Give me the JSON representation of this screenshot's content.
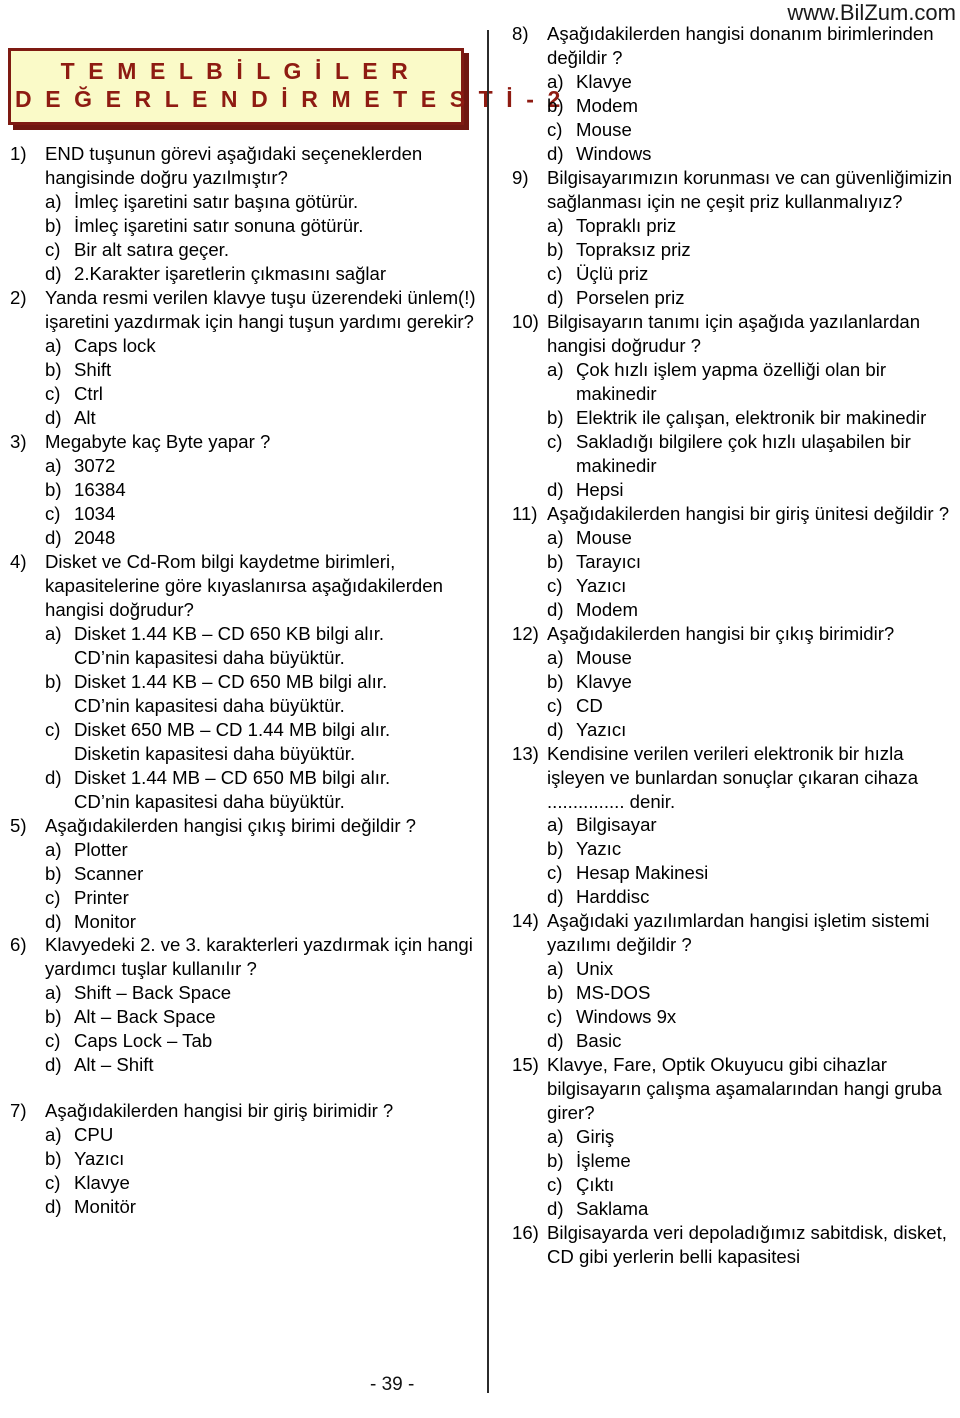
{
  "document": {
    "title_line_1": "T E M E L   B İ L G İ L E R",
    "title_line_2": "D E Ğ E R L E N D İ R M E   T E S T İ - 2",
    "watermark": "www.BilZum.com",
    "page_number": "- 39 -",
    "banner_fill_color": "#fafac8",
    "banner_border_color": "#7e1a12",
    "banner_text_color": "#8e1b12"
  },
  "left_column": {
    "questions": [
      {
        "number": "1)",
        "text": "END tuşunun görevi aşağıdaki seçeneklerden hangisinde doğru yazılmıştır?",
        "options": [
          {
            "letter": "a)",
            "text": "İmleç işaretini satır başına götürür."
          },
          {
            "letter": "b)",
            "text": "İmleç işaretini satır sonuna götürür."
          },
          {
            "letter": "c)",
            "text": "Bir alt satıra geçer."
          },
          {
            "letter": "d)",
            "text": "2.Karakter işaretlerin çıkmasını sağlar"
          }
        ]
      },
      {
        "number": "2)",
        "text": "Yanda resmi verilen klavye tuşu üzerendeki ünlem(!) işaretini yazdırmak için hangi tuşun yardımı gerekir?",
        "options": [
          {
            "letter": "a)",
            "text": "Caps lock"
          },
          {
            "letter": "b)",
            "text": "Shift"
          },
          {
            "letter": "c)",
            "text": "Ctrl"
          },
          {
            "letter": "d)",
            "text": "Alt"
          }
        ]
      },
      {
        "number": "3)",
        "text": "Megabyte kaç Byte yapar ?",
        "options": [
          {
            "letter": "a)",
            "text": "3072"
          },
          {
            "letter": "b)",
            "text": "16384"
          },
          {
            "letter": "c)",
            "text": "1034"
          },
          {
            "letter": "d)",
            "text": "2048"
          }
        ]
      },
      {
        "number": "4)",
        "text": "Disket ve Cd-Rom bilgi kaydetme birimleri, kapasitelerine göre kıyaslanırsa aşağıdakilerden hangisi doğrudur?",
        "options": [
          {
            "letter": "a)",
            "text": "Disket 1.44 KB – CD 650 KB bilgi alır.",
            "cont": "CD’nin kapasitesi daha büyüktür."
          },
          {
            "letter": "b)",
            "text": "Disket 1.44 KB – CD 650 MB bilgi alır.",
            "cont": "CD’nin kapasitesi daha büyüktür."
          },
          {
            "letter": "c)",
            "text": "Disket 650 MB – CD 1.44 MB bilgi alır.",
            "cont": "Disketin kapasitesi daha büyüktür."
          },
          {
            "letter": "d)",
            "text": "Disket 1.44 MB – CD 650 MB bilgi alır.",
            "cont": "CD’nin kapasitesi daha büyüktür."
          }
        ]
      },
      {
        "number": "5)",
        "text": "Aşağıdakilerden hangisi çıkış birimi değildir ?",
        "options": [
          {
            "letter": "a)",
            "text": "Plotter"
          },
          {
            "letter": "b)",
            "text": "Scanner"
          },
          {
            "letter": "c)",
            "text": "Printer"
          },
          {
            "letter": "d)",
            "text": "Monitor"
          }
        ]
      },
      {
        "number": "6)",
        "text": "Klavyedeki 2. ve 3. karakterleri yazdırmak için hangi yardımcı tuşlar kullanılır ?",
        "options": [
          {
            "letter": "a)",
            "text": "Shift – Back Space"
          },
          {
            "letter": "b)",
            "text": "Alt – Back Space"
          },
          {
            "letter": "c)",
            "text": "Caps Lock – Tab"
          },
          {
            "letter": "d)",
            "text": "Alt – Shift"
          }
        ],
        "gap_after": true
      },
      {
        "number": "7)",
        "text": "Aşağıdakilerden hangisi bir giriş birimidir ?",
        "options": [
          {
            "letter": "a)",
            "text": "CPU"
          },
          {
            "letter": "b)",
            "text": "Yazıcı"
          },
          {
            "letter": "c)",
            "text": "Klavye"
          },
          {
            "letter": "d)",
            "text": "Monitör"
          }
        ]
      }
    ]
  },
  "right_column": {
    "questions": [
      {
        "number": "8)",
        "text": "Aşağıdakilerden hangisi donanım birimlerinden değildir ?",
        "options": [
          {
            "letter": "a)",
            "text": "Klavye"
          },
          {
            "letter": "b)",
            "text": "Modem"
          },
          {
            "letter": "c)",
            "text": "Mouse"
          },
          {
            "letter": "d)",
            "text": "Windows"
          }
        ]
      },
      {
        "number": "9)",
        "text": "Bilgisayarımızın korunması ve can güvenliğimizin sağlanması için ne çeşit priz kullanmalıyız?",
        "options": [
          {
            "letter": "a)",
            "text": "Topraklı priz"
          },
          {
            "letter": "b)",
            "text": "Topraksız priz"
          },
          {
            "letter": "c)",
            "text": "Üçlü priz"
          },
          {
            "letter": "d)",
            "text": "Porselen priz"
          }
        ]
      },
      {
        "number": "10)",
        "text": "Bilgisayarın tanımı için aşağıda yazılanlardan hangisi doğrudur ?",
        "options": [
          {
            "letter": "a)",
            "text": "Çok hızlı işlem yapma özelliği olan bir makinedir"
          },
          {
            "letter": "b)",
            "text": "Elektrik ile çalışan, elektronik bir makinedir"
          },
          {
            "letter": "c)",
            "text": "Sakladığı bilgilere çok hızlı ulaşabilen bir makinedir"
          },
          {
            "letter": "d)",
            "text": "Hepsi"
          }
        ]
      },
      {
        "number": "11)",
        "text": "Aşağıdakilerden hangisi bir giriş ünitesi değildir ?",
        "options": [
          {
            "letter": "a)",
            "text": "Mouse"
          },
          {
            "letter": "b)",
            "text": "Tarayıcı"
          },
          {
            "letter": "c)",
            "text": "Yazıcı"
          },
          {
            "letter": "d)",
            "text": "Modem"
          }
        ]
      },
      {
        "number": "12)",
        "text": "Aşağıdakilerden hangisi bir çıkış birimidir?",
        "options": [
          {
            "letter": "a)",
            "text": "Mouse"
          },
          {
            "letter": "b)",
            "text": "Klavye"
          },
          {
            "letter": "c)",
            "text": "CD"
          },
          {
            "letter": "d)",
            "text": "Yazıcı"
          }
        ]
      },
      {
        "number": "13)",
        "text": "Kendisine verilen verileri elektronik bir hızla işleyen ve bunlardan sonuçlar çıkaran cihaza ............... denir.",
        "options": [
          {
            "letter": "a)",
            "text": "Bilgisayar"
          },
          {
            "letter": "b)",
            "text": "Yazıc"
          },
          {
            "letter": "c)",
            "text": "Hesap Makinesi"
          },
          {
            "letter": "d)",
            "text": "Harddisc"
          }
        ]
      },
      {
        "number": "14)",
        "text": "Aşağıdaki yazılımlardan hangisi işletim sistemi yazılımı değildir ?",
        "options": [
          {
            "letter": "a)",
            "text": "Unix"
          },
          {
            "letter": "b)",
            "text": "MS-DOS"
          },
          {
            "letter": "c)",
            "text": "Windows 9x"
          },
          {
            "letter": "d)",
            "text": "Basic"
          }
        ]
      },
      {
        "number": "15)",
        "text": "Klavye, Fare, Optik Okuyucu gibi cihazlar bilgisayarın çalışma aşamalarından hangi gruba girer?",
        "options": [
          {
            "letter": "a)",
            "text": "Giriş"
          },
          {
            "letter": "b)",
            "text": "İşleme"
          },
          {
            "letter": "c)",
            "text": "Çıktı"
          },
          {
            "letter": "d)",
            "text": "Saklama"
          }
        ]
      },
      {
        "number": "16)",
        "text": "Bilgisayarda veri depoladığımız sabitdisk, disket, CD gibi yerlerin belli kapasitesi",
        "options": []
      }
    ]
  }
}
